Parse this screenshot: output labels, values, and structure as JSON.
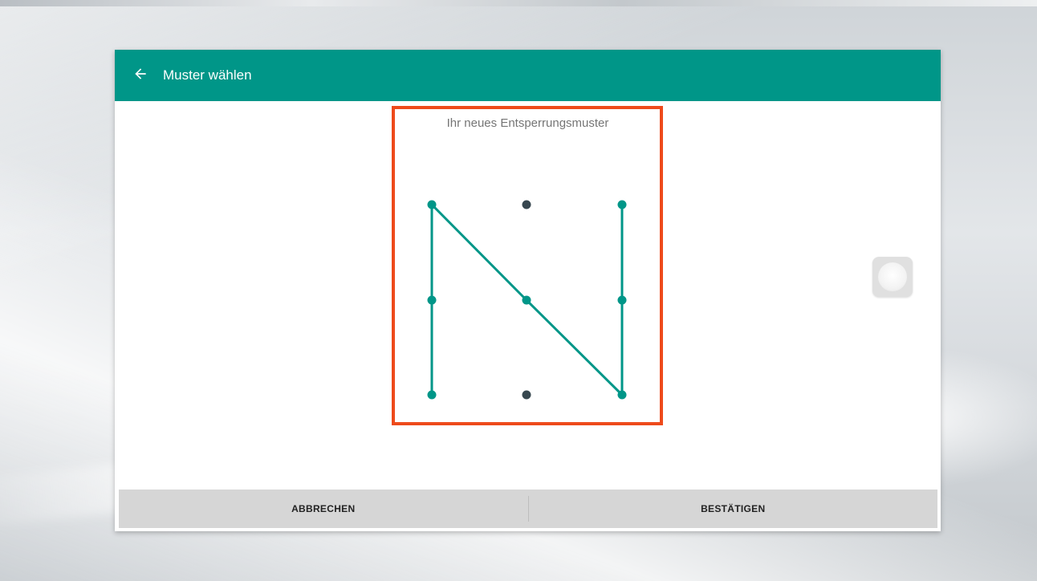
{
  "toolbar": {
    "back_icon": "arrow-left-icon",
    "title": "Muster wählen",
    "color": "#009688"
  },
  "pattern": {
    "title": "Ihr neues Entsperrungsmuster",
    "highlight_color": "#ee4a1b",
    "line_color": "#009688",
    "inactive_dot_color": "#37474f",
    "grid": [
      [
        1,
        2,
        3
      ],
      [
        4,
        5,
        6
      ],
      [
        7,
        8,
        9
      ]
    ],
    "sequence": [
      7,
      4,
      1,
      5,
      9,
      6,
      3
    ]
  },
  "buttons": {
    "cancel": "ABBRECHEN",
    "confirm": "BESTÄTIGEN"
  },
  "floating_button": {
    "icon": "assistive-touch-icon"
  }
}
